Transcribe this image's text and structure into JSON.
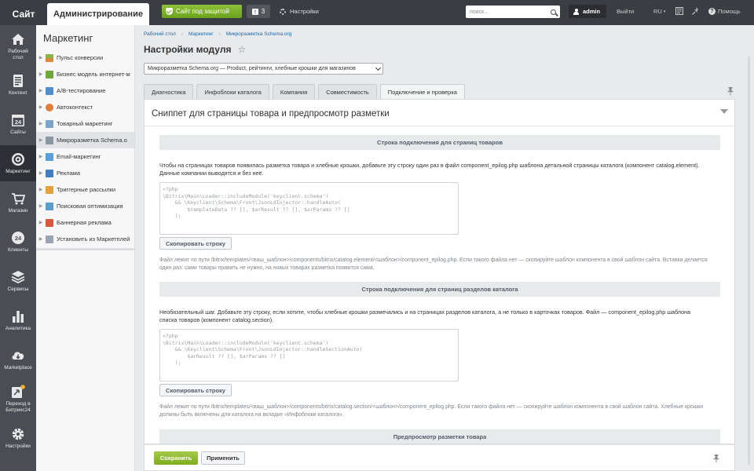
{
  "topbar": {
    "site_tab": "Сайт",
    "admin_tab": "Администрирование",
    "secure_label": "Сайт под защитой",
    "notifications_count": "3",
    "settings_label": "Настройки",
    "search_placeholder": "поиск...",
    "user_name": "admin",
    "logout_label": "Выйти",
    "lang_label": "RU",
    "help_label": "Помощь"
  },
  "iconbar": {
    "items": [
      {
        "label": "Рабочий стол",
        "icon": "home-icon"
      },
      {
        "label": "Контент",
        "icon": "document-icon"
      },
      {
        "label": "Сайты",
        "icon": "calendar-icon",
        "badge": "24"
      },
      {
        "label": "Маркетинг",
        "icon": "target-icon"
      },
      {
        "label": "Магазин",
        "icon": "cart-icon"
      },
      {
        "label": "Клиенты",
        "icon": "clients-icon",
        "badge": "24"
      },
      {
        "label": "Сервисы",
        "icon": "layers-icon"
      },
      {
        "label": "Аналитика",
        "icon": "bar-chart-icon"
      },
      {
        "label": "Marketplace",
        "icon": "cloud-download-icon"
      },
      {
        "label": "Переход в Битрикс24",
        "icon": "bitrix24-icon"
      },
      {
        "label": "Настройки",
        "icon": "gear-icon"
      }
    ]
  },
  "sidebar": {
    "title": "Маркетинг",
    "items": [
      {
        "label": "Пульс конверсии"
      },
      {
        "label": "Бизнес модель интернет-м"
      },
      {
        "label": "A/B-тестирование"
      },
      {
        "label": "Автоконтекст"
      },
      {
        "label": "Товарный маркетинг"
      },
      {
        "label": "Микроразметка Schema.o"
      },
      {
        "label": "Email-маркетинг"
      },
      {
        "label": "Реклама"
      },
      {
        "label": "Триггерные рассылки"
      },
      {
        "label": "Поисковая оптимизация"
      },
      {
        "label": "Баннерная реклама"
      },
      {
        "label": "Установить из Маркетплей"
      }
    ]
  },
  "main": {
    "breadcrumb": [
      "Рабочий стол",
      "Маркетинг",
      "Микроразметка Schema.org"
    ],
    "page_title": "Настройки модуля",
    "module_select": "Микроразметка Schema.org — Product, рейтинги, хлебные крошки для магазинов",
    "tabs": [
      {
        "label": "Диагностика"
      },
      {
        "label": "Инфоблоки каталога"
      },
      {
        "label": "Компания"
      },
      {
        "label": "Совместимость"
      },
      {
        "label": "Подключение и проверка"
      }
    ],
    "card_title": "Сниппет для страницы товара и предпросмотр разметки",
    "section1": {
      "heading": "Строка подключения для страниц товаров",
      "description": "Чтобы на страницах товаров появилась разметка товара и хлебные крошки, добавьте эту строку один раз в файл component_epilog.php шаблона детальной страницы каталога (компонент catalog.element). Данные компании выводятся и без неё.",
      "code": "<?php\n\\Bitrix\\Main\\Loader::includeModule('keyclient.schema')\n    && \\Keyclient\\Schema\\Front\\JsonLdInjector::handleAuto(\n        $templateData ?? [], $arResult ?? [], $arParams ?? []\n    );",
      "copy_label": "Скопировать строку",
      "note": "Файл лежит по пути /bitrix/templates/<ваш_шаблон>/components/bitrix/catalog.element/<шаблон>/component_epilog.php. Если такого файла нет — скопируйте шаблон компонента в свой шаблон сайта. Вставка делается один раз: сами товары править не нужно, на новых товарах разметка появится сама."
    },
    "section2": {
      "heading": "Строка подключения для страниц разделов каталога",
      "description": "Необязательный шаг. Добавьте эту строку, если хотите, чтобы хлебные крошки размечались и на страницах разделов каталога, а не только в карточках товаров. Файл — component_epilog.php шаблона списка товаров (компонент catalog.section).",
      "code": "<?php\n\\Bitrix\\Main\\Loader::includeModule('keyclient.schema')\n    && \\Keyclient\\Schema\\Front\\JsonLdInjector::handleSectionAuto(\n        $arResult ?? [], $arParams ?? []\n    );",
      "copy_label": "Скопировать строку",
      "note": "Файл лежит по пути /bitrix/templates/<ваш_шаблон>/components/bitrix/catalog.section/<шаблон>/component_epilog.php. Если такого файла нет — скопируйте шаблон компонента в свой шаблон сайта. Хлебные крошки должны быть включены для каталога на вкладке «Инфоблоки каталога»."
    },
    "section3": {
      "heading": "Предпросмотр разметки товара"
    },
    "save_label": "Сохранить",
    "apply_label": "Применить"
  },
  "colors": {
    "topbar_bg": "#3a3d42",
    "iconbar_bg": "#4a4e54",
    "accent_green": "#7fad1d",
    "link_blue": "#2067b0"
  }
}
